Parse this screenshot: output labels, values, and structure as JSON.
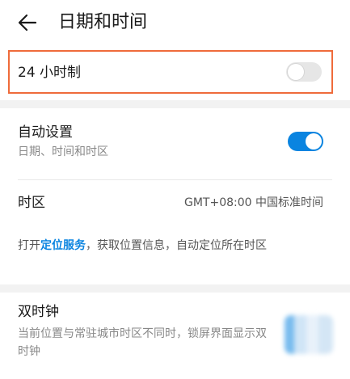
{
  "header": {
    "title": "日期和时间",
    "back_icon": "arrow-left-icon"
  },
  "row_24h": {
    "label": "24 小时制",
    "enabled": false
  },
  "auto_setting": {
    "title": "自动设置",
    "subtitle": "日期、时间和时区",
    "enabled": true
  },
  "timezone": {
    "title": "时区",
    "value": "GMT+08:00 中国标准时间"
  },
  "location_hint": {
    "prefix": "打开",
    "link": "定位服务",
    "suffix": "，获取位置信息，自动定位所在时区"
  },
  "dual_clock": {
    "title": "双时钟",
    "subtitle": "当前位置与常驻城市时区不同时，锁屏界面显示双时钟"
  },
  "colors": {
    "accent": "#0a84e0",
    "highlight_border": "#ef6b3b"
  }
}
